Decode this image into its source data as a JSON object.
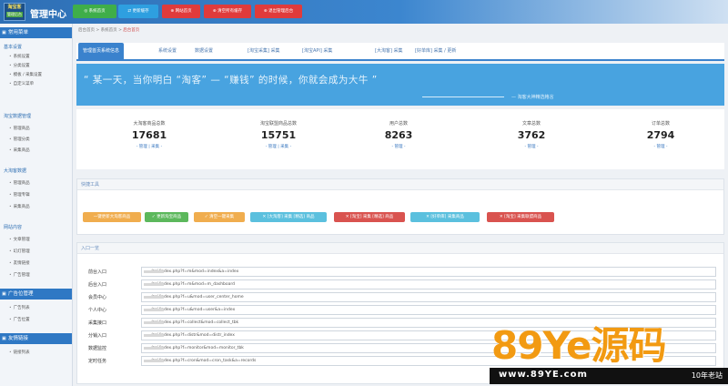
{
  "header": {
    "logo_text": "淘宝客",
    "logo_sub": "管理后台",
    "title": "管理中心",
    "buttons": [
      {
        "label": "◎ 系统首页",
        "color": "#3fae49"
      },
      {
        "label": "⇄ 更新缓存",
        "color": "#2e9fe0"
      },
      {
        "label": "⊕ 网站首页",
        "color": "#e03b3b"
      },
      {
        "label": "⊕ 清空所有缓存",
        "color": "#e03b3b"
      },
      {
        "label": "⊕ 退出管理后台",
        "color": "#e03b3b"
      }
    ]
  },
  "sidebar": {
    "groups": [
      {
        "label": "常用菜单",
        "sections": [
          {
            "label": "基本设置",
            "items": [
              "系统设置",
              "分类设置",
              "模板 / 采集设置",
              "自定义菜单"
            ]
          }
        ]
      },
      {
        "label": "",
        "sections": [
          {
            "label": "淘宝数据管理",
            "items": [
              "管理商品",
              "管理分类",
              "采集商品"
            ]
          },
          {
            "label": "大淘客数据",
            "items": [
              "管理商品",
              "管理专辑",
              "采集商品"
            ]
          },
          {
            "label": "网站内容",
            "items": [
              "文章管理",
              "幻灯管理",
              "友情链接",
              "广告管理"
            ]
          }
        ]
      },
      {
        "label": "广告位管理",
        "sections": [
          {
            "label": "",
            "items": [
              "广告列表",
              "广告位置"
            ]
          }
        ]
      },
      {
        "label": "友情链接",
        "sections": [
          {
            "label": "",
            "items": [
              "链接列表"
            ]
          }
        ]
      }
    ]
  },
  "breadcrumb": {
    "home": "后台首页",
    "sep1": " > ",
    "mid": "系统首页",
    "sep2": " > ",
    "current": "后台首页"
  },
  "tabs": [
    {
      "label": "管理首页系统信息",
      "active": true
    },
    {
      "label": "系统设置"
    },
    {
      "label": "数据设置"
    },
    {
      "label": "[淘宝采集] 采集"
    },
    {
      "label": "[淘宝API] 采集"
    },
    {
      "label": "[大淘客] 采集"
    },
    {
      "label": "[好单库] 采集 / 更新"
    }
  ],
  "banner": {
    "quote": "“ 某一天，当你明白 “淘客” — “赚钱” 的时候，你就会成为大牛 ”",
    "author": "— 淘客大神精选格言"
  },
  "stats": [
    {
      "label": "大淘客商品总数",
      "value": "17681",
      "link": "- 管理 | 采集 -"
    },
    {
      "label": "淘宝联盟商品总数",
      "value": "15751",
      "link": "- 管理 | 采集 -"
    },
    {
      "label": "用户总数",
      "value": "8263",
      "link": "- 管理 -"
    },
    {
      "label": "文章总数",
      "value": "3762",
      "link": "- 管理 -"
    },
    {
      "label": "订单总数",
      "value": "2794",
      "link": "- 管理 -"
    }
  ],
  "quick": {
    "title": "快捷工具",
    "buttons": [
      {
        "label": "一键更新大淘客商品",
        "color": "#f0ad4e"
      },
      {
        "label": "✓ 更新淘宝商品",
        "color": "#5cb85c"
      },
      {
        "label": "✓ 清空一键采集",
        "color": "#f0ad4e"
      },
      {
        "label": "✕ [大淘客] 采集 [精选] 商品",
        "color": "#5bc0de"
      },
      {
        "label": "✕ [淘宝] 采集 [精选] 商品",
        "color": "#d9534f"
      },
      {
        "label": "✕ [好单库] 采集商品",
        "color": "#5bc0de"
      },
      {
        "label": "✕ [淘宝] 采集联盟商品",
        "color": "#d9534f"
      }
    ]
  },
  "links": {
    "title": "入口一览",
    "rows": [
      {
        "label": "前台入口",
        "value": "/api/index.php?f=m&mod=index&a=index"
      },
      {
        "label": "后台入口",
        "value": "/api/index.php?f=m&mod=m_dashboard"
      },
      {
        "label": "会员中心",
        "value": "/api/index.php?f=u&mod=user_center_home"
      },
      {
        "label": "个人中心",
        "value": "/api/index.php?f=u&mod=user&a=index"
      },
      {
        "label": "采集接口",
        "value": "/api/index.php?f=collect&mod=collect_tbk"
      },
      {
        "label": "分销入口",
        "value": "/api/index.php?f=distr&mod=distr_index"
      },
      {
        "label": "数据监控",
        "value": "/api/index.php?f=monitor&mod=monitor_tbk"
      },
      {
        "label": "定时任务",
        "value": "/api/index.php?f=cron&mod=cron_task&a=records"
      }
    ]
  },
  "watermark": {
    "brand": "89Ye源码",
    "url": "www.89YE.com",
    "tag": "10年老站"
  }
}
